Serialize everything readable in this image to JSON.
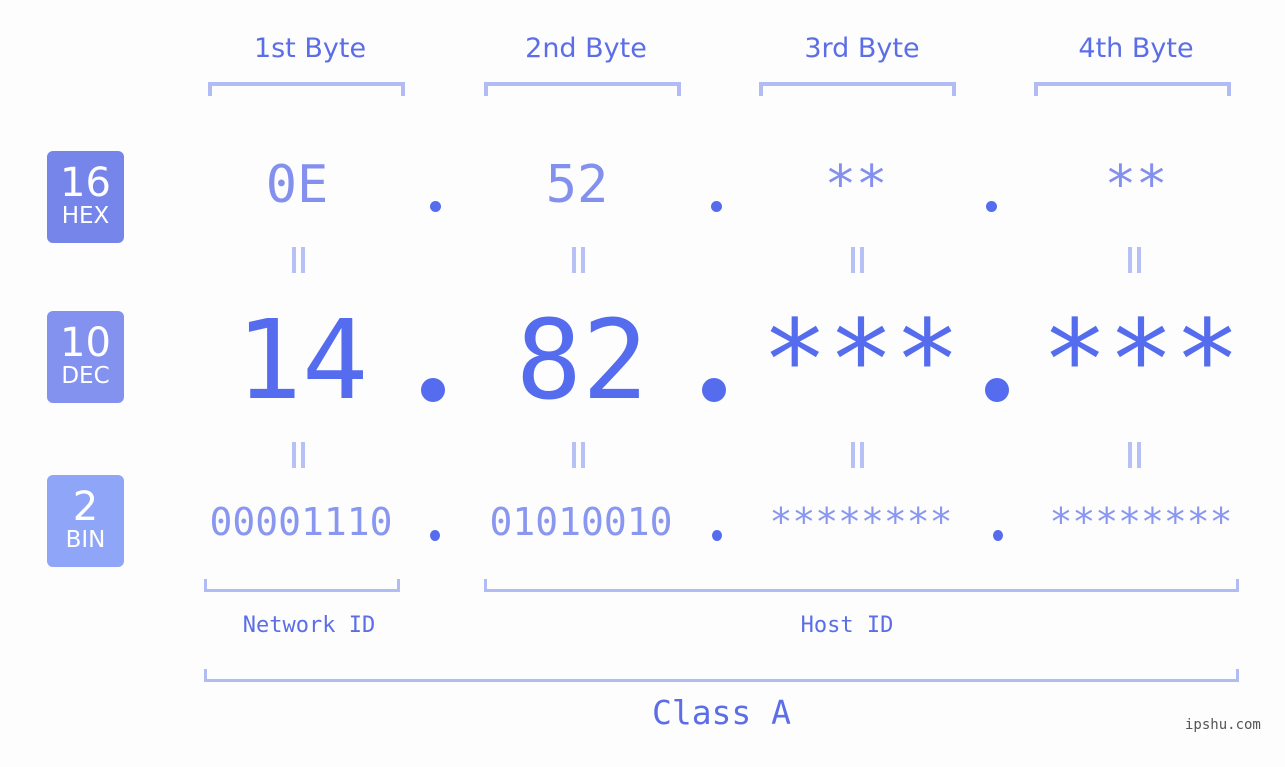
{
  "bytes": [
    {
      "label": "1st Byte",
      "hex": "0E",
      "dec": "14",
      "bin": "00001110"
    },
    {
      "label": "2nd Byte",
      "hex": "52",
      "dec": "82",
      "bin": "01010010"
    },
    {
      "label": "3rd Byte",
      "hex": "**",
      "dec": "***",
      "bin": "********"
    },
    {
      "label": "4th Byte",
      "hex": "**",
      "dec": "***",
      "bin": "********"
    }
  ],
  "bases": [
    {
      "num": "16",
      "label": "HEX",
      "color": "#7585ea"
    },
    {
      "num": "10",
      "label": "DEC",
      "color": "#8392ef"
    },
    {
      "num": "2",
      "label": "BIN",
      "color": "#8fa5f7"
    }
  ],
  "sections": {
    "network": "Network ID",
    "host": "Host ID"
  },
  "class_label": "Class A",
  "watermark": "ipshu.com",
  "colors": {
    "accent": "#546ced",
    "bracket": "#b1bcf5",
    "background": "#fcfdfc"
  }
}
